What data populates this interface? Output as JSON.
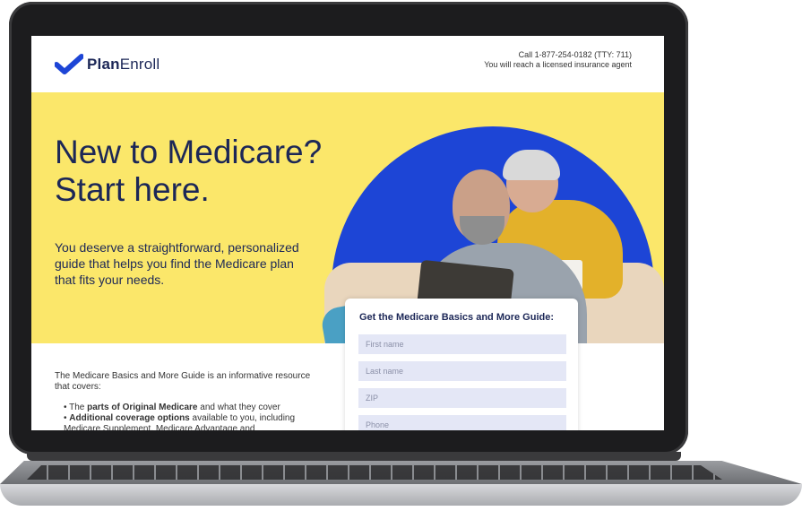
{
  "header": {
    "logo_text_bold": "Plan",
    "logo_text_regular": "Enroll",
    "call_line1": "Call 1-877-254-0182 (TTY: 711)",
    "call_line2": "You will reach a licensed insurance agent"
  },
  "hero": {
    "heading_line1": "New to Medicare?",
    "heading_line2": "Start here.",
    "lead": "You deserve a straightforward, personalized guide that helps you find the Medicare plan that fits your needs."
  },
  "content": {
    "intro": "The Medicare Basics and More Guide is an informative resource that covers:",
    "bullets": [
      {
        "pre": "The ",
        "bold": "parts of Original Medicare",
        "post": " and what they cover"
      },
      {
        "pre": "",
        "bold": "Additional coverage options",
        "post": " available to you, including Medicare Supplement, Medicare Advantage and"
      }
    ]
  },
  "form": {
    "title": "Get the Medicare Basics and More Guide:",
    "fields": [
      {
        "placeholder": "First name"
      },
      {
        "placeholder": "Last name"
      },
      {
        "placeholder": "ZIP"
      },
      {
        "placeholder": "Phone"
      }
    ]
  },
  "colors": {
    "brand_navy": "#1c2757",
    "brand_blue": "#1d45d6",
    "hero_yellow": "#fbe76a",
    "field_bg": "#e4e7f6"
  },
  "icons": {
    "logo": "checkmark-icon"
  }
}
